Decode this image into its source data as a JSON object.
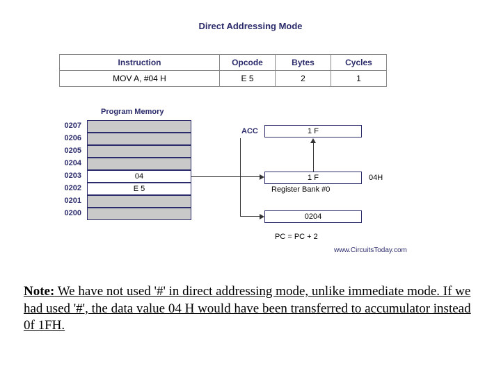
{
  "title": "Direct Addressing Mode",
  "table": {
    "headers": {
      "c1": "Instruction",
      "c2": "Opcode",
      "c3": "Bytes",
      "c4": "Cycles"
    },
    "row": {
      "c1": "MOV A, #04 H",
      "c2": "E 5",
      "c3": "2",
      "c4": "1"
    }
  },
  "pm_title": "Program Memory",
  "addrs": [
    "0207",
    "0206",
    "0205",
    "0204",
    "0203",
    "0202",
    "0201",
    "0200"
  ],
  "mem": {
    "r4": "04",
    "r5": "E 5"
  },
  "acc_label": "ACC",
  "acc_value": "1 F",
  "reg_value": "1 F",
  "reg_label": "Register Bank #0",
  "reg_right": "04H",
  "pc_value": "0204",
  "pc_text": "PC = PC + 2",
  "credit": "www.CircuitsToday.com",
  "note_prefix": "Note:",
  "note_body": " We have not used '#' in direct addressing mode, unlike immediate mode. If we had used '#', the data value 04 H would have been transferred to accumulator instead 0f 1FH."
}
